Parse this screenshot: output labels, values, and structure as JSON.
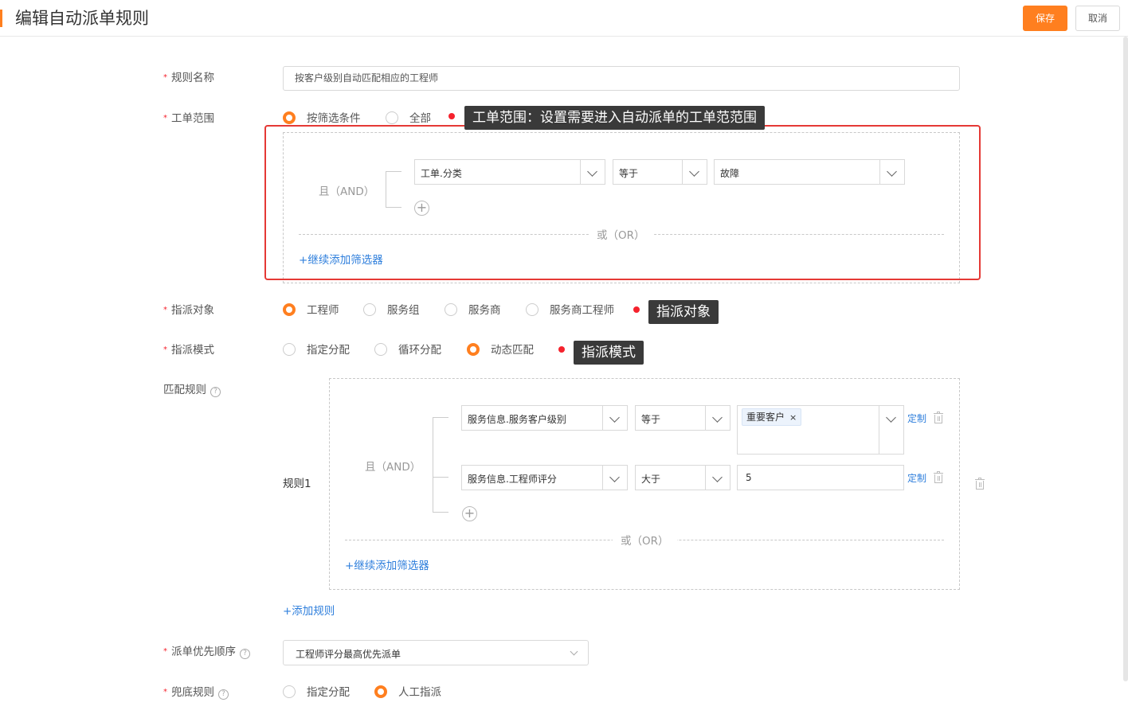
{
  "header": {
    "title": "编辑自动派单规则",
    "save_label": "保存",
    "cancel_label": "取消"
  },
  "form": {
    "rule_name": {
      "label": "规则名称",
      "value": "按客户级别自动匹配相应的工程师"
    },
    "scope": {
      "label": "工单范围",
      "options": [
        "按筛选条件",
        "全部"
      ],
      "selected": "按筛选条件",
      "and_label": "且（AND）",
      "condition": {
        "field": "工单.分类",
        "operator": "等于",
        "value": "故障"
      },
      "or_label": "或（OR）",
      "add_filter": "+继续添加筛选器"
    },
    "assign_target": {
      "label": "指派对象",
      "options": [
        "工程师",
        "服务组",
        "服务商",
        "服务商工程师"
      ],
      "selected": "工程师"
    },
    "assign_mode": {
      "label": "指派模式",
      "options": [
        "指定分配",
        "循环分配",
        "动态匹配"
      ],
      "selected": "动态匹配"
    },
    "match_rules": {
      "label": "匹配规则",
      "help": "?",
      "rule_name": "规则1",
      "and_label": "且（AND）",
      "conditions": [
        {
          "field": "服务信息.服务客户级别",
          "operator": "等于",
          "tag": "重要客户",
          "tag_close": "×",
          "custom": "定制"
        },
        {
          "field": "服务信息.工程师评分",
          "operator": "大于",
          "value": "5",
          "custom": "定制"
        }
      ],
      "or_label": "或（OR）",
      "add_filter": "+继续添加筛选器",
      "add_rule": "+添加规则"
    },
    "priority": {
      "label": "派单优先顺序",
      "help": "?",
      "value": "工程师评分最高优先派单"
    },
    "fallback": {
      "label": "兜底规则",
      "help": "?",
      "options": [
        "指定分配",
        "人工指派"
      ],
      "selected": "人工指派"
    }
  },
  "annotations": {
    "scope_callout": "工单范围：设置需要进入自动派单的工单范范围",
    "target_callout": "指派对象",
    "mode_callout": "指派模式"
  },
  "colors": {
    "accent": "#ff7f1f",
    "link": "#2f7fdc",
    "annotation_red": "#e53935",
    "required": "#f5222d"
  }
}
